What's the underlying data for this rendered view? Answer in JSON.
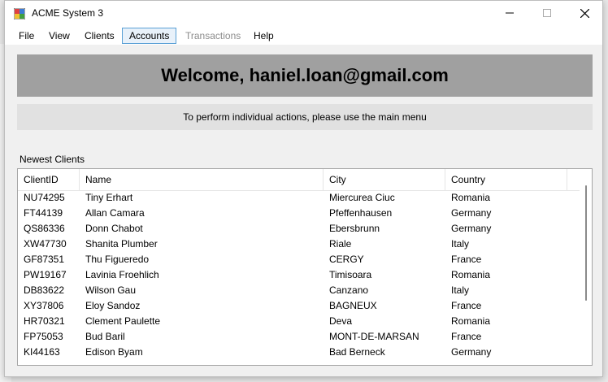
{
  "window": {
    "title": "ACME System 3"
  },
  "menu": [
    {
      "label": "File",
      "state": "normal"
    },
    {
      "label": "View",
      "state": "normal"
    },
    {
      "label": "Clients",
      "state": "normal"
    },
    {
      "label": "Accounts",
      "state": "active"
    },
    {
      "label": "Transactions",
      "state": "disabled"
    },
    {
      "label": "Help",
      "state": "normal"
    }
  ],
  "welcome": "Welcome, haniel.loan@gmail.com",
  "instructions": "To perform individual actions, please use the main menu",
  "grid": {
    "label": "Newest Clients",
    "columns": [
      "ClientID",
      "Name",
      "City",
      "Country"
    ],
    "rows": [
      [
        "NU74295",
        "Tiny Erhart",
        "Miercurea Ciuc",
        "Romania"
      ],
      [
        "FT44139",
        "Allan Camara",
        "Pfeffenhausen",
        "Germany"
      ],
      [
        "QS86336",
        "Donn Chabot",
        "Ebersbrunn",
        "Germany"
      ],
      [
        "XW47730",
        "Shanita Plumber",
        "Riale",
        "Italy"
      ],
      [
        "GF87351",
        "Thu Figueredo",
        "CERGY",
        "France"
      ],
      [
        "PW19167",
        "Lavinia Froehlich",
        "Timisoara",
        "Romania"
      ],
      [
        "DB83622",
        "Wilson Gau",
        "Canzano",
        "Italy"
      ],
      [
        "XY37806",
        "Eloy Sandoz",
        "BAGNEUX",
        "France"
      ],
      [
        "HR70321",
        "Clement Paulette",
        "Deva",
        "Romania"
      ],
      [
        "FP75053",
        "Bud Baril",
        "MONT-DE-MARSAN",
        "France"
      ],
      [
        "KI44163",
        "Edison Byam",
        "Bad Berneck",
        "Germany"
      ]
    ]
  },
  "colors": {
    "welcome_bg": "#a0a0a0",
    "active_menu_border": "#5aa0d6"
  }
}
